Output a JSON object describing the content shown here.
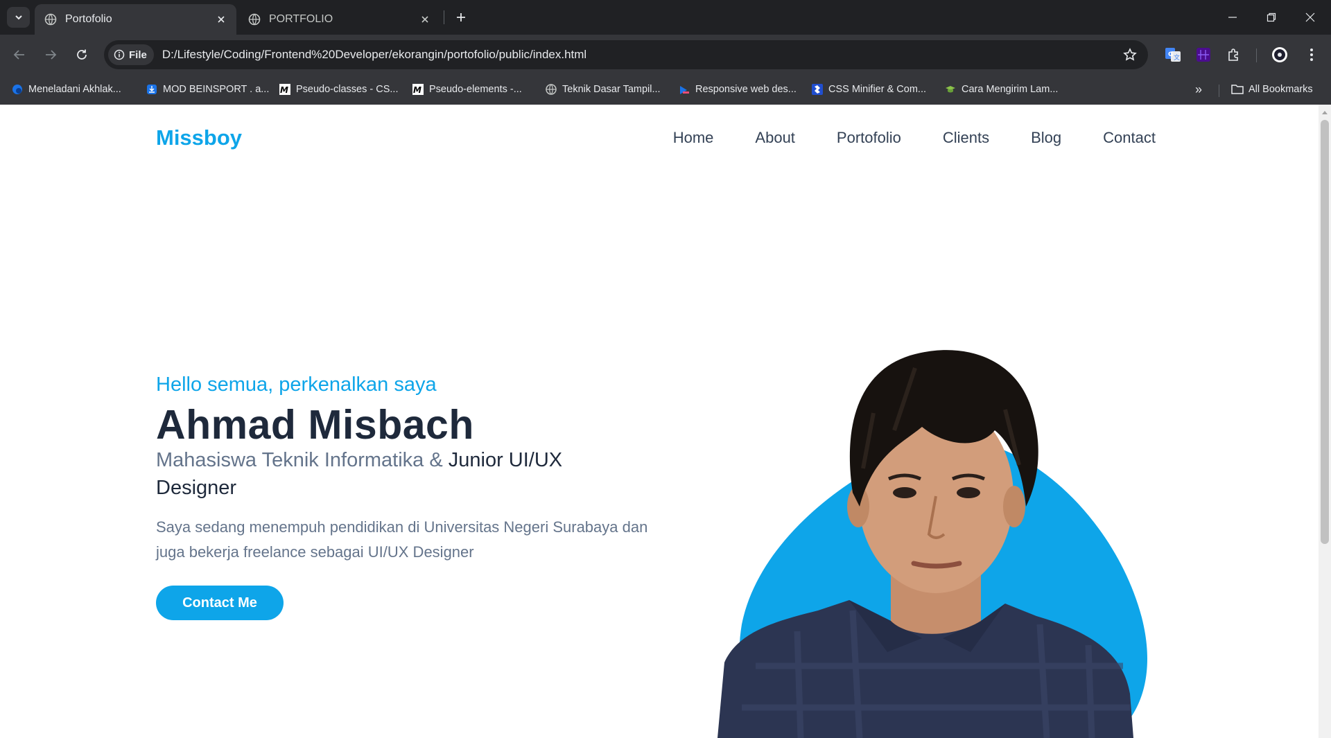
{
  "browser": {
    "tabs": [
      {
        "title": "Portofolio",
        "active": true
      },
      {
        "title": "PORTFOLIO",
        "active": false
      }
    ],
    "omnibox": {
      "scheme_chip": "File",
      "url": "D:/Lifestyle/Coding/Frontend%20Developer/ekorangin/portofolio/public/index.html"
    },
    "bookmarks": [
      {
        "label": "Meneladani Akhlak...",
        "icon": "globe-blue-icon"
      },
      {
        "label": "MOD BEINSPORT . a...",
        "icon": "download-icon"
      },
      {
        "label": "Pseudo-classes - CS...",
        "icon": "mdn-icon"
      },
      {
        "label": "Pseudo-elements -...",
        "icon": "mdn-icon"
      },
      {
        "label": "Teknik Dasar Tampil...",
        "icon": "globe-icon"
      },
      {
        "label": "Responsive web des...",
        "icon": "chrome-dev-icon"
      },
      {
        "label": "CSS Minifier & Com...",
        "icon": "toptal-icon"
      },
      {
        "label": "Cara Mengirim Lam...",
        "icon": "graduation-cap-icon"
      }
    ],
    "all_bookmarks_label": "All Bookmarks",
    "colors": {
      "frame": "#202124",
      "toolbar": "#35363a"
    }
  },
  "site": {
    "brand": "Missboy",
    "nav": [
      "Home",
      "About",
      "Portofolio",
      "Clients",
      "Blog",
      "Contact"
    ],
    "hero": {
      "greeting": "Hello semua, perkenalkan saya",
      "name": "Ahmad Misbach",
      "role_muted": "Mahasiswa Teknik Informatika &",
      "role_strong": "Junior UI/UX Designer",
      "description": "Saya sedang menempuh pendidikan di Universitas Negeri Surabaya dan juga bekerja freelance sebagai UI/UX Designer",
      "cta_label": "Contact Me"
    },
    "colors": {
      "accent": "#0ea5e9",
      "heading": "#1e293b",
      "muted": "#64748b"
    }
  }
}
